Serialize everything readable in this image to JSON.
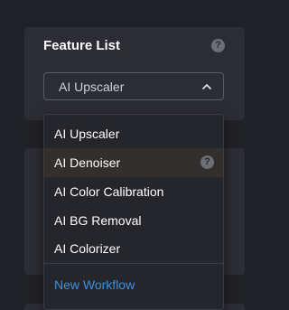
{
  "panel": {
    "title": "Feature List",
    "help_icon": "?",
    "select": {
      "value": "AI Upscaler",
      "chevron_icon": "chevron-up-icon"
    }
  },
  "dropdown": {
    "items": [
      {
        "label": "AI Upscaler"
      },
      {
        "label": "AI Denoiser",
        "help_icon": "?"
      },
      {
        "label": "AI Color Calibration"
      },
      {
        "label": "AI BG Removal"
      },
      {
        "label": "AI Colorizer"
      }
    ],
    "new_workflow": "New Workflow"
  },
  "colors": {
    "background": "#212227",
    "panel": "#2c2d34",
    "menu": "#25262c",
    "hover": "#322f2c",
    "link": "#3e8fdc"
  }
}
